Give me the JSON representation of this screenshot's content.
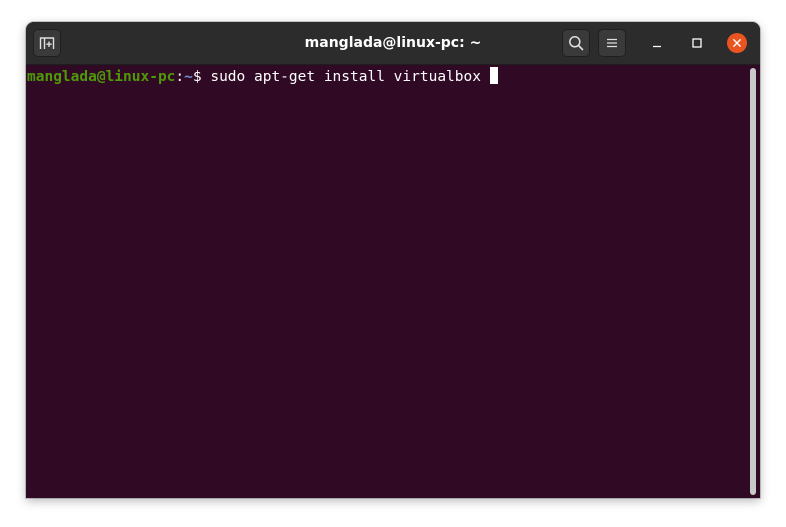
{
  "window": {
    "title": "manglada@linux-pc: ~"
  },
  "titlebar": {
    "new_tab_icon": "new-tab-icon",
    "search_icon": "search-icon",
    "menu_icon": "hamburger-menu-icon",
    "minimize_icon": "minimize-icon",
    "maximize_icon": "maximize-icon",
    "close_icon": "close-icon"
  },
  "terminal": {
    "prompt_user": "manglada@linux-pc",
    "prompt_sep": ":",
    "prompt_path": "~",
    "prompt_symbol": "$ ",
    "command": "sudo apt-get install virtualbox"
  },
  "colors": {
    "background": "#300a24",
    "titlebar": "#2c2c2c",
    "prompt_user": "#4e9a06",
    "prompt_path": "#6f8fd0",
    "close_button": "#e95420"
  }
}
